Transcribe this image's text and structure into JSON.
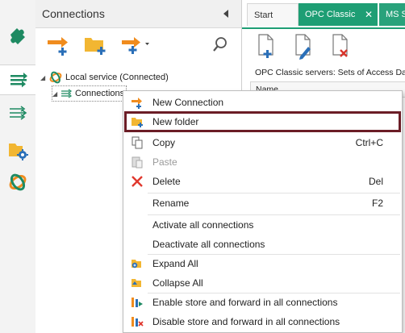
{
  "rail": {
    "items": [
      {
        "icon": "puzzle-icon"
      },
      {
        "icon": "connections-icon"
      },
      {
        "icon": "routing-icon"
      },
      {
        "icon": "folder-gear-icon"
      },
      {
        "icon": "link-ring-icon"
      }
    ]
  },
  "panel": {
    "title": "Connections",
    "toolbar": [
      {
        "icon": "new-connection-icon"
      },
      {
        "icon": "new-folder-icon"
      },
      {
        "icon": "new-connection-dropdown-icon"
      },
      {
        "icon": "search-icon"
      }
    ],
    "tree": [
      {
        "label": "Local service (Connected)"
      },
      {
        "label": "Connections"
      }
    ]
  },
  "right": {
    "tabs": [
      {
        "label": "Start"
      },
      {
        "label": "OPC Classic"
      },
      {
        "label": "MS SQ"
      }
    ],
    "subtitle": "OPC Classic servers: Sets of Access Da",
    "grid_header": "Name"
  },
  "context_menu": {
    "items": [
      {
        "label": "New Connection",
        "shortcut": "",
        "icon": "new-connection-icon"
      },
      {
        "label": "New folder",
        "shortcut": "",
        "icon": "new-folder-icon"
      },
      {
        "label": "Copy",
        "shortcut": "Ctrl+C",
        "icon": "copy-icon"
      },
      {
        "label": "Paste",
        "shortcut": "",
        "icon": "paste-icon"
      },
      {
        "label": "Delete",
        "shortcut": "Del",
        "icon": "delete-icon"
      },
      {
        "label": "Rename",
        "shortcut": "F2",
        "icon": ""
      },
      {
        "label": "Activate all connections",
        "shortcut": "",
        "icon": ""
      },
      {
        "label": "Deactivate all connections",
        "shortcut": "",
        "icon": ""
      },
      {
        "label": "Expand All",
        "shortcut": "",
        "icon": "expand-all-icon"
      },
      {
        "label": "Collapse All",
        "shortcut": "",
        "icon": "collapse-all-icon"
      },
      {
        "label": "Enable store and forward in all connections",
        "shortcut": "",
        "icon": "enable-store-icon"
      },
      {
        "label": "Disable store and forward in all connections",
        "shortcut": "",
        "icon": "disable-store-icon"
      }
    ]
  },
  "colors": {
    "accent": "#1e9e74",
    "highlight_border": "#6b1d26",
    "folder": "#f2b632",
    "arrow": "#f08c1e",
    "plus": "#2a6fb8"
  }
}
